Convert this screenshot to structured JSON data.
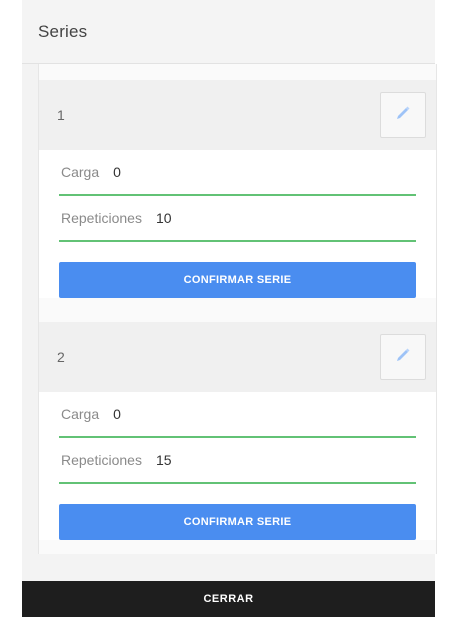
{
  "panel": {
    "title": "Series"
  },
  "series": [
    {
      "number": "1",
      "fields": [
        {
          "label": "Carga",
          "value": "0"
        },
        {
          "label": "Repeticiones",
          "value": "10"
        }
      ],
      "confirm_label": "CONFIRMAR SERIE",
      "edit_icon": "pencil-icon"
    },
    {
      "number": "2",
      "fields": [
        {
          "label": "Carga",
          "value": "0"
        },
        {
          "label": "Repeticiones",
          "value": "15"
        }
      ],
      "confirm_label": "CONFIRMAR SERIE",
      "edit_icon": "pencil-icon"
    }
  ],
  "footer": {
    "close_label": "CERRAR"
  },
  "colors": {
    "accent": "#4a8df0",
    "underline": "#62c275",
    "footer_bg": "#1e1e1e"
  }
}
